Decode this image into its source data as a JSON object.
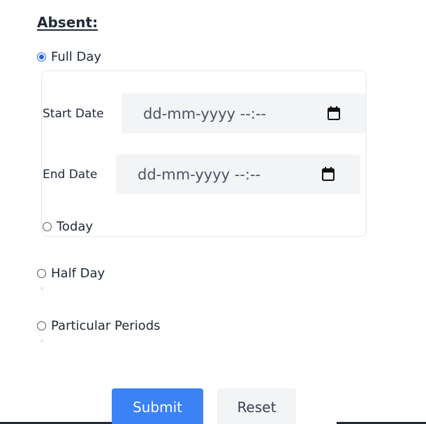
{
  "form": {
    "section_title": "Absent:",
    "options": {
      "full_day": "Full Day",
      "today": "Today",
      "half_day": "Half Day",
      "particular_periods": "Particular Periods"
    },
    "selected_option": "Full Day",
    "start_date": {
      "label": "Start Date",
      "placeholder": "dd-mm-yyyy --:--",
      "icon": "calendar-icon"
    },
    "end_date": {
      "label": "End Date",
      "placeholder": "dd-mm-yyyy --:--",
      "icon": "calendar-icon"
    },
    "buttons": {
      "submit": "Submit",
      "reset": "Reset"
    }
  },
  "colors": {
    "accent": "#2563eb",
    "submit_bg": "#3b82f6",
    "input_bg": "#f3f4f6"
  }
}
